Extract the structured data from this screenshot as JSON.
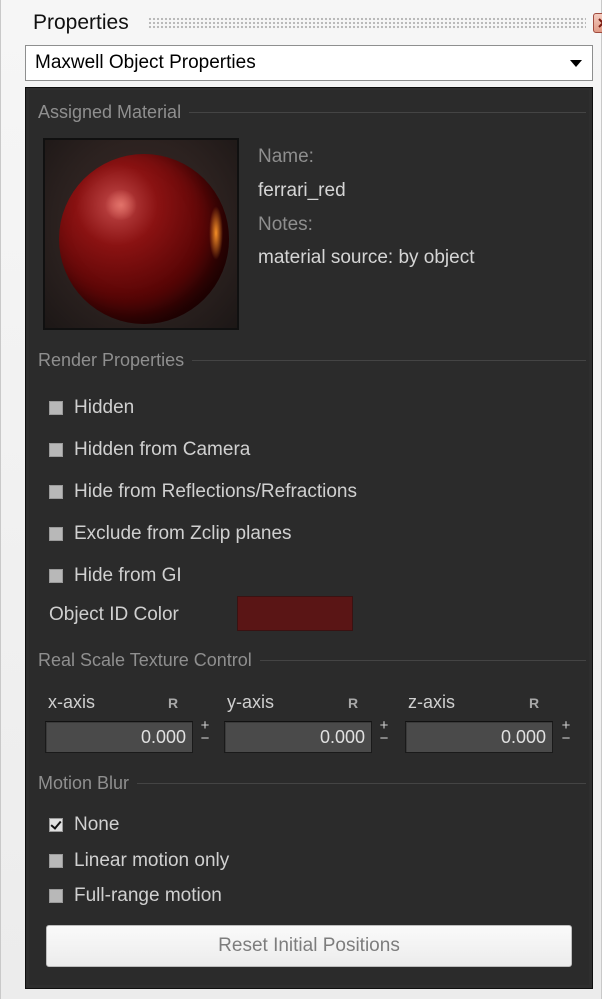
{
  "window": {
    "title": "Properties",
    "dropdown_value": "Maxwell Object Properties"
  },
  "assigned_material": {
    "section_title": "Assigned Material",
    "name_label": "Name:",
    "name_value": "ferrari_red",
    "notes_label": "Notes:",
    "notes_value": "material source: by object"
  },
  "render_properties": {
    "section_title": "Render Properties",
    "options": [
      {
        "label": "Hidden",
        "checked": false
      },
      {
        "label": "Hidden from Camera",
        "checked": false
      },
      {
        "label": "Hide from Reflections/Refractions",
        "checked": false
      },
      {
        "label": "Exclude from Zclip planes",
        "checked": false
      },
      {
        "label": "Hide from GI",
        "checked": false
      }
    ],
    "object_id_label": "Object ID Color",
    "object_id_color": "#5a1515"
  },
  "real_scale": {
    "section_title": "Real Scale Texture Control",
    "axes": [
      {
        "label": "x-axis",
        "r": "R",
        "value": "0.000"
      },
      {
        "label": "y-axis",
        "r": "R",
        "value": "0.000"
      },
      {
        "label": "z-axis",
        "r": "R",
        "value": "0.000"
      }
    ],
    "plus": "+",
    "minus": "−"
  },
  "motion_blur": {
    "section_title": "Motion Blur",
    "options": [
      {
        "label": "None",
        "checked": true
      },
      {
        "label": "Linear motion only",
        "checked": false
      },
      {
        "label": "Full-range motion",
        "checked": false
      }
    ],
    "reset_label": "Reset Initial Positions"
  },
  "colors": {
    "panel_bg": "#2b2b2b",
    "material": "#8a1212"
  }
}
